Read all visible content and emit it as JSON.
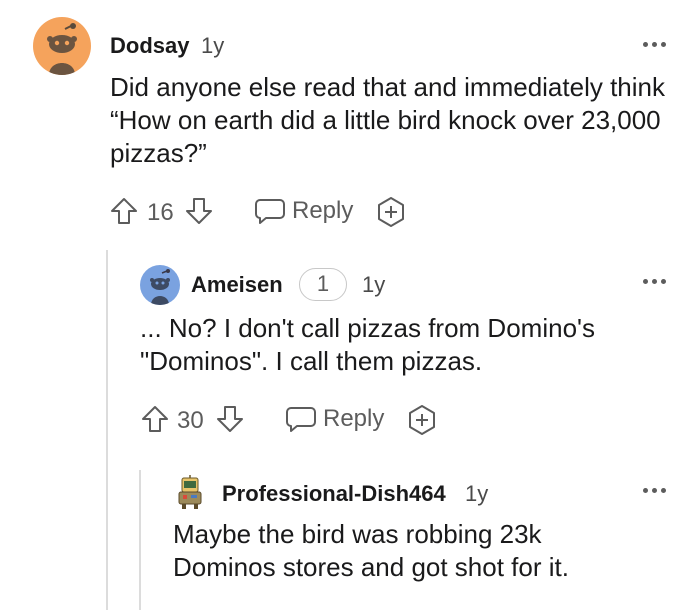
{
  "comments": [
    {
      "username": "Dodsay",
      "age": "1y",
      "text": "Did anyone else read that and immediately think “How on earth did a little bird knock over 23,000 pizzas?”",
      "votes": "16",
      "reply_label": "Reply",
      "avatar_icon": "snoo-avatar-icon"
    },
    {
      "username": "Ameisen",
      "flair": "1",
      "age": "1y",
      "text": "... No? I don't call pizzas from Domino's \"Dominos\". I call them pizzas.",
      "votes": "30",
      "reply_label": "Reply",
      "avatar_icon": "snoo-avatar-icon"
    },
    {
      "username": "Professional-Dish464",
      "age": "1y",
      "text": "Maybe the bird was robbing 23k Dominos stores and got shot for it.",
      "avatar_icon": "custom-avatar-icon"
    }
  ],
  "colors": {
    "avatar_orange": "#f5a35c",
    "avatar_blue": "#7aa2e0",
    "icon_gray": "#5c5c5c",
    "thread_line": "#dcdcdc"
  }
}
